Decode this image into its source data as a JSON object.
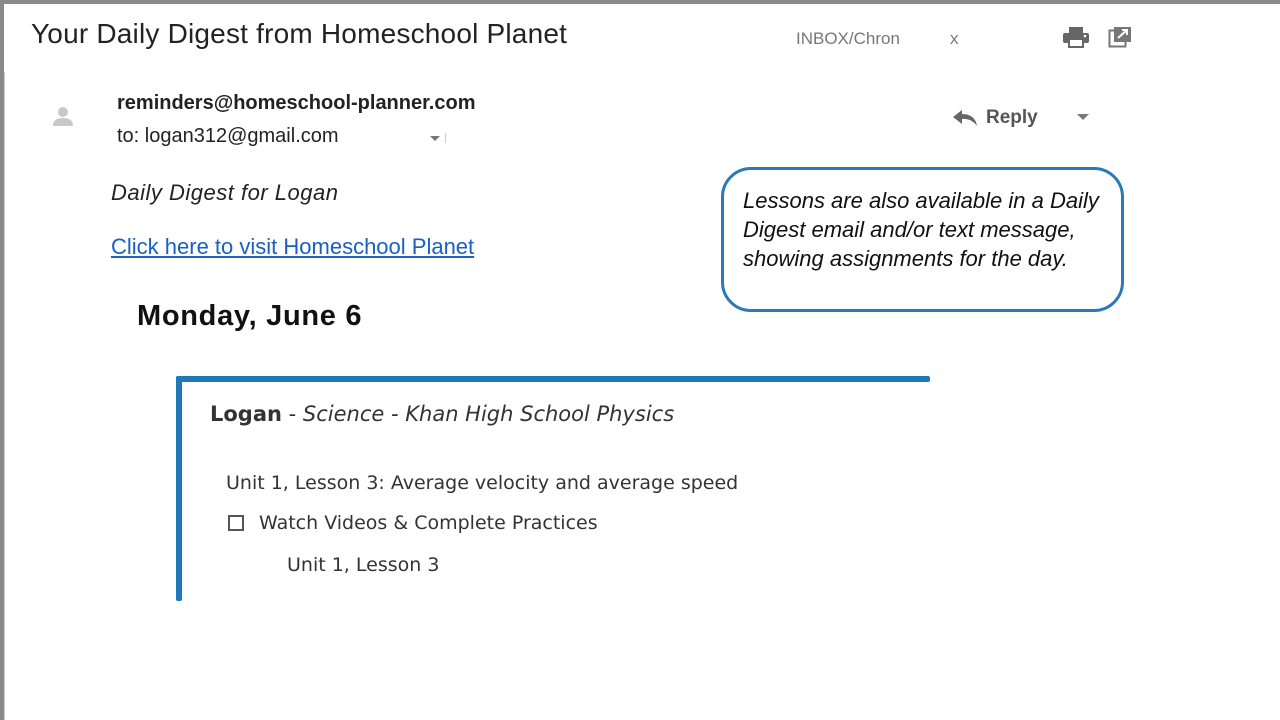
{
  "email": {
    "subject": "Your Daily Digest from Homeschool Planet",
    "folder": "INBOX/Chron",
    "folder_close": "x",
    "sender": "reminders@homeschool-planner.com",
    "recipient": "to: logan312@gmail.com",
    "reply_label": "Reply",
    "icons": {
      "print": "print-icon",
      "popout": "popout-icon",
      "avatar": "person-icon",
      "reply": "reply-arrow-icon",
      "dropdown": "chevron-down-icon"
    }
  },
  "body": {
    "digest_heading": "Daily Digest for Logan",
    "visit_link": "Click here to visit Homeschool Planet",
    "date_heading": "Monday, June 6"
  },
  "callout": {
    "text": "Lessons are also available in a Daily Digest email and/or text message, showing assignments for the day."
  },
  "assignment": {
    "student": "Logan",
    "separator": " - ",
    "course": "Science - Khan High School Physics",
    "lesson": "Unit 1, Lesson 3: Average velocity and average speed",
    "task": "Watch Videos & Complete Practices",
    "task_checked": false,
    "task_detail": "Unit 1, Lesson 3"
  },
  "colors": {
    "accent_blue": "#1f78b8",
    "link_blue": "#1a5fc4",
    "callout_border": "#2a7ab7"
  }
}
